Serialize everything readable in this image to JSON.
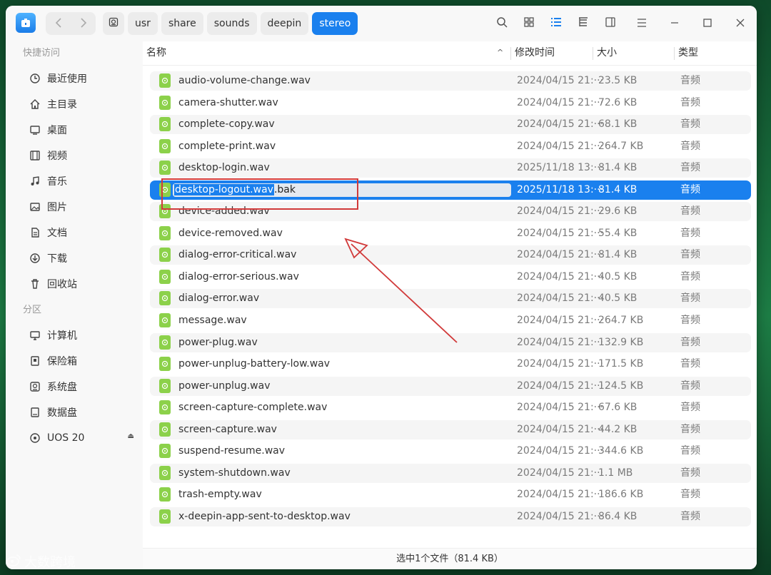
{
  "toolbar": {
    "back_icon": "chevron-left-icon",
    "forward_icon": "chevron-right-icon",
    "breadcrumbs": [
      "usr",
      "share",
      "sounds",
      "deepin",
      "stereo"
    ]
  },
  "sidebar": {
    "quick_access_title": "快捷访问",
    "quick_items": [
      {
        "label": "最近使用",
        "icon": "clock-icon"
      },
      {
        "label": "主目录",
        "icon": "home-icon"
      },
      {
        "label": "桌面",
        "icon": "desktop-icon"
      },
      {
        "label": "视频",
        "icon": "video-icon"
      },
      {
        "label": "音乐",
        "icon": "music-icon"
      },
      {
        "label": "图片",
        "icon": "picture-icon"
      },
      {
        "label": "文档",
        "icon": "document-icon"
      },
      {
        "label": "下载",
        "icon": "download-icon"
      },
      {
        "label": "回收站",
        "icon": "trash-icon"
      }
    ],
    "partition_title": "分区",
    "partition_items": [
      {
        "label": "计算机",
        "icon": "computer-icon"
      },
      {
        "label": "保险箱",
        "icon": "vault-icon"
      },
      {
        "label": "系统盘",
        "icon": "system-disk-icon"
      },
      {
        "label": "数据盘",
        "icon": "data-disk-icon"
      },
      {
        "label": "UOS 20",
        "icon": "optical-disc-icon"
      }
    ]
  },
  "columns": {
    "name": "名称",
    "modified": "修改时间",
    "size": "大小",
    "type": "类型"
  },
  "files": [
    {
      "name": "audio-volume-change.wav",
      "date": "2024/04/15 21:···",
      "size": "23.5 KB",
      "type": "音频"
    },
    {
      "name": "camera-shutter.wav",
      "date": "2024/04/15 21:···",
      "size": "72.6 KB",
      "type": "音频"
    },
    {
      "name": "complete-copy.wav",
      "date": "2024/04/15 21:···",
      "size": "68.1 KB",
      "type": "音频"
    },
    {
      "name": "complete-print.wav",
      "date": "2024/04/15 21:···",
      "size": "264.7 KB",
      "type": "音频"
    },
    {
      "name": "desktop-login.wav",
      "date": "2025/11/18 13:···",
      "size": "81.4 KB",
      "type": "音频"
    },
    {
      "name": "desktop-logout.wav.bak",
      "date": "2025/11/18 13:···",
      "size": "81.4 KB",
      "type": "音频"
    },
    {
      "name": "device-added.wav",
      "date": "2024/04/15 21:···",
      "size": "29.6 KB",
      "type": "音频"
    },
    {
      "name": "device-removed.wav",
      "date": "2024/04/15 21:···",
      "size": "55.4 KB",
      "type": "音频"
    },
    {
      "name": "dialog-error-critical.wav",
      "date": "2024/04/15 21:···",
      "size": "81.4 KB",
      "type": "音频"
    },
    {
      "name": "dialog-error-serious.wav",
      "date": "2024/04/15 21:···",
      "size": "40.5 KB",
      "type": "音频"
    },
    {
      "name": "dialog-error.wav",
      "date": "2024/04/15 21:···",
      "size": "40.5 KB",
      "type": "音频"
    },
    {
      "name": "message.wav",
      "date": "2024/04/15 21:···",
      "size": "264.7 KB",
      "type": "音频"
    },
    {
      "name": "power-plug.wav",
      "date": "2024/04/15 21:···",
      "size": "132.9 KB",
      "type": "音频"
    },
    {
      "name": "power-unplug-battery-low.wav",
      "date": "2024/04/15 21:···",
      "size": "171.5 KB",
      "type": "音频"
    },
    {
      "name": "power-unplug.wav",
      "date": "2024/04/15 21:···",
      "size": "124.5 KB",
      "type": "音频"
    },
    {
      "name": "screen-capture-complete.wav",
      "date": "2024/04/15 21:···",
      "size": "67.6 KB",
      "type": "音频"
    },
    {
      "name": "screen-capture.wav",
      "date": "2024/04/15 21:···",
      "size": "44.2 KB",
      "type": "音频"
    },
    {
      "name": "suspend-resume.wav",
      "date": "2024/04/15 21:···",
      "size": "344.6 KB",
      "type": "音频"
    },
    {
      "name": "system-shutdown.wav",
      "date": "2024/04/15 21:···",
      "size": "1.1 MB",
      "type": "音频"
    },
    {
      "name": "trash-empty.wav",
      "date": "2024/04/15 21:···",
      "size": "186.6 KB",
      "type": "音频"
    },
    {
      "name": "x-deepin-app-sent-to-desktop.wav",
      "date": "2024/04/15 21:···",
      "size": "86.4 KB",
      "type": "音频"
    }
  ],
  "rename": {
    "selected_part": "desktop-logout.wav",
    "typed_suffix": ".bak"
  },
  "status_text": "选中1个文件（81.4 KB）",
  "watermark": "大数跨境",
  "colors": {
    "accent": "#1a80ee",
    "annotation": "#d13a3a",
    "file_icon": "#8cd14a"
  }
}
